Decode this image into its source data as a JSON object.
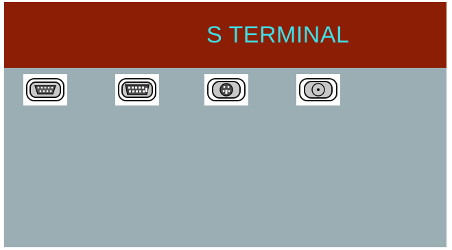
{
  "osd": {
    "title": "S TERMINAL",
    "colors": {
      "title_bar": "#8b1e05",
      "title_text": "#3fe0e8",
      "background": "#9aaeb4",
      "icon_tile": "#ffffff"
    }
  },
  "inputs": [
    {
      "icon": "vga-connector-icon"
    },
    {
      "icon": "dvi-connector-icon"
    },
    {
      "icon": "s-video-connector-icon",
      "selected": true
    },
    {
      "icon": "composite-video-connector-icon"
    }
  ]
}
